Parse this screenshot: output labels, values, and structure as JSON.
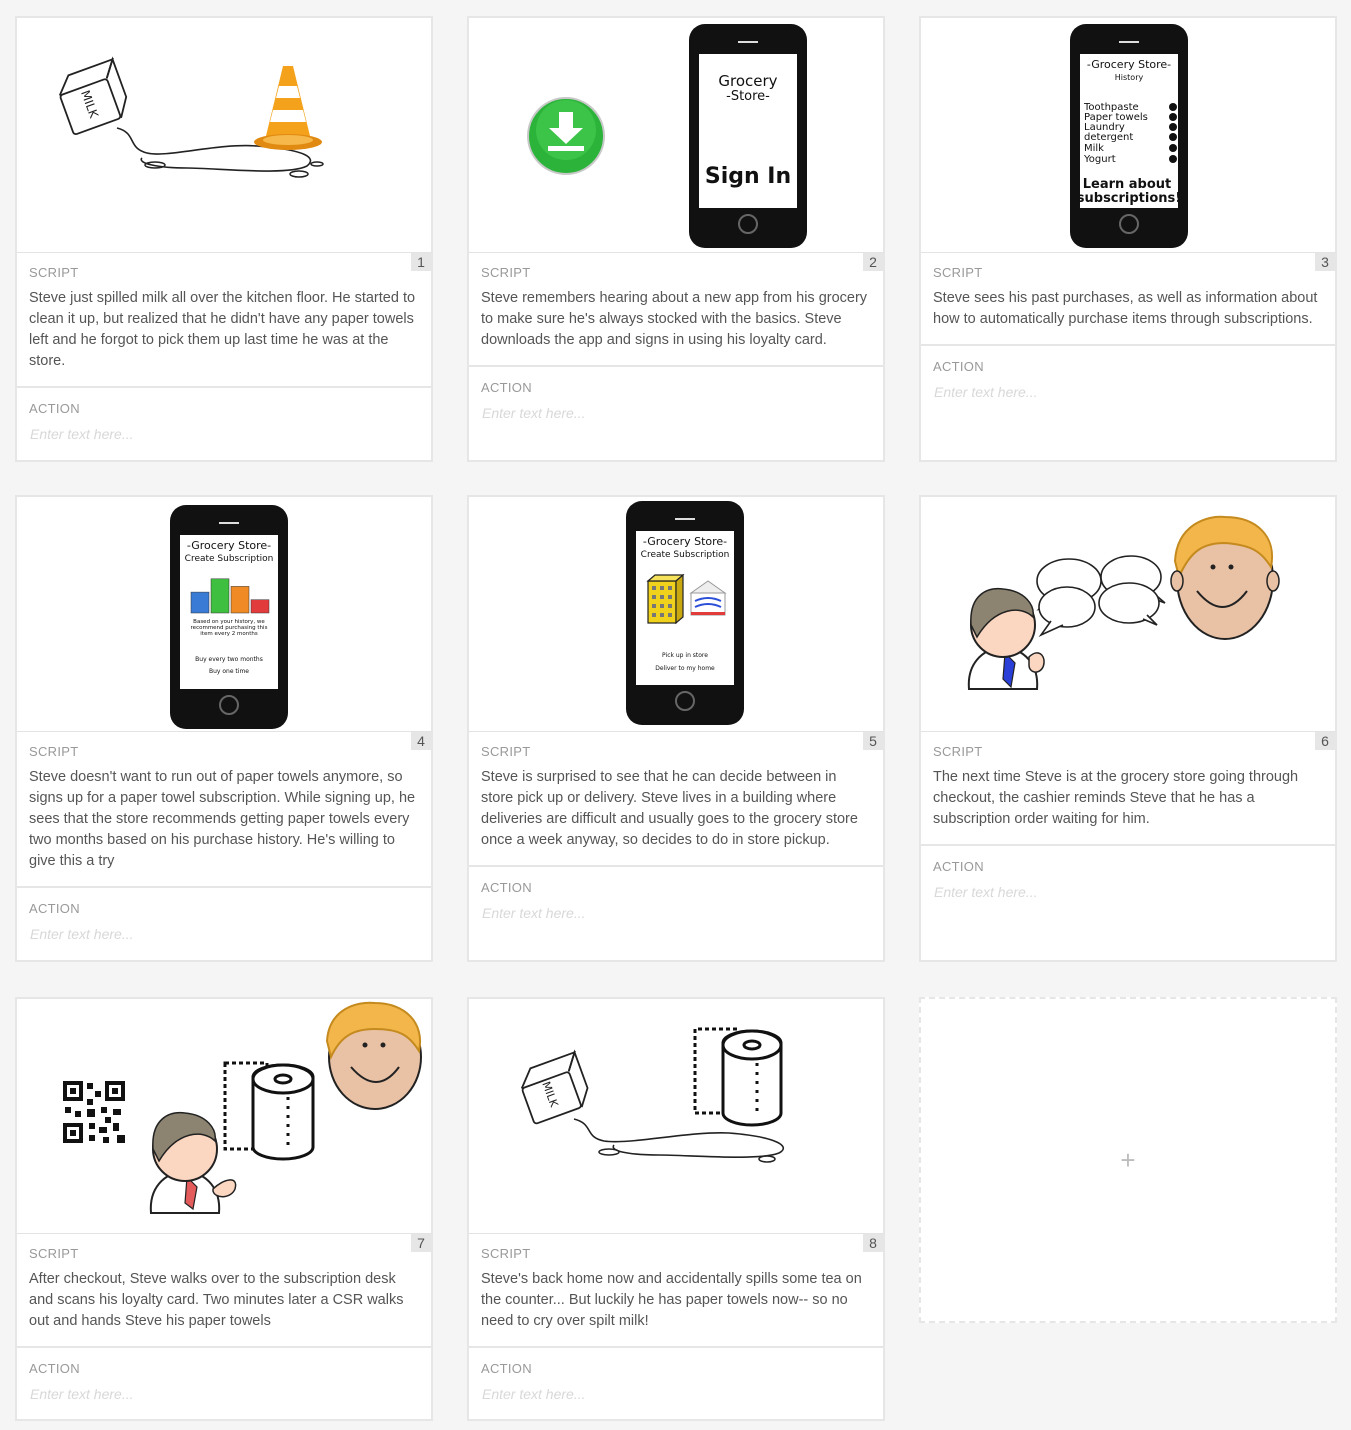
{
  "labels": {
    "script": "SCRIPT",
    "action": "ACTION",
    "action_placeholder": "Enter text here..."
  },
  "add_card_symbol": "+",
  "cards": [
    {
      "number": "1",
      "script": "Steve just spilled milk all over the kitchen floor. He started to clean it up, but realized that he didn't have any paper towels left and he forgot to pick them up last time he was at the store.",
      "image": {
        "milk_label": "MILK"
      }
    },
    {
      "number": "2",
      "script": "Steve remembers hearing about a new app from his grocery to make sure he's always stocked with the basics. Steve downloads the app and signs in using his loyalty card.",
      "image": {
        "phone_line1": "Grocery",
        "phone_line2": "-Store-",
        "phone_line3": "Sign In"
      }
    },
    {
      "number": "3",
      "script": "Steve sees his past purchases, as well as information about how to automatically purchase items through subscriptions.",
      "image": {
        "title": "-Grocery Store-",
        "subtitle": "History",
        "items": [
          "Toothpaste",
          "Paper towels",
          "Laundry",
          "detergent",
          "Milk",
          "Yogurt"
        ],
        "footer1": "Learn about",
        "footer2": "subscriptions!"
      }
    },
    {
      "number": "4",
      "script": "Steve doesn't want to run out of paper towels anymore, so signs up for a paper towel subscription. While signing up, he sees that the store recommends getting paper towels every two months based on his purchase history. He's willing to give this a try",
      "image": {
        "title": "-Grocery Store-",
        "subtitle": "Create Subscription",
        "note1": "Based on your history, we",
        "note2": "recommend purchasing this",
        "note3": "item every 2 months",
        "option1": "Buy every two months",
        "option2": "Buy one time",
        "bar_colors": [
          "#3a7bd5",
          "#3fbf3f",
          "#f08a24",
          "#e23b3b"
        ],
        "bar_values": [
          0.55,
          0.9,
          0.7,
          0.35
        ]
      }
    },
    {
      "number": "5",
      "script": "Steve is surprised to see that he can decide between in store pick up or delivery. Steve lives in a building where deliveries are difficult and usually goes to the grocery store once a week anyway, so decides to do in store pickup.",
      "image": {
        "title": "-Grocery Store-",
        "subtitle": "Create Subscription",
        "option1": "Pick up in store",
        "option2": "Deliver to my home"
      }
    },
    {
      "number": "6",
      "script": "The next time Steve is at the grocery store going through checkout, the cashier reminds Steve that he has a subscription order waiting for him.",
      "image": {}
    },
    {
      "number": "7",
      "script": "After checkout, Steve walks over to the subscription desk and scans his loyalty card. Two minutes later a CSR walks out and hands Steve his paper towels",
      "image": {}
    },
    {
      "number": "8",
      "script": "Steve's back home now and accidentally spills some tea on the counter... But luckily he has paper towels now-- so no need to cry over spilt milk!",
      "image": {
        "milk_label": "MILK"
      }
    }
  ]
}
